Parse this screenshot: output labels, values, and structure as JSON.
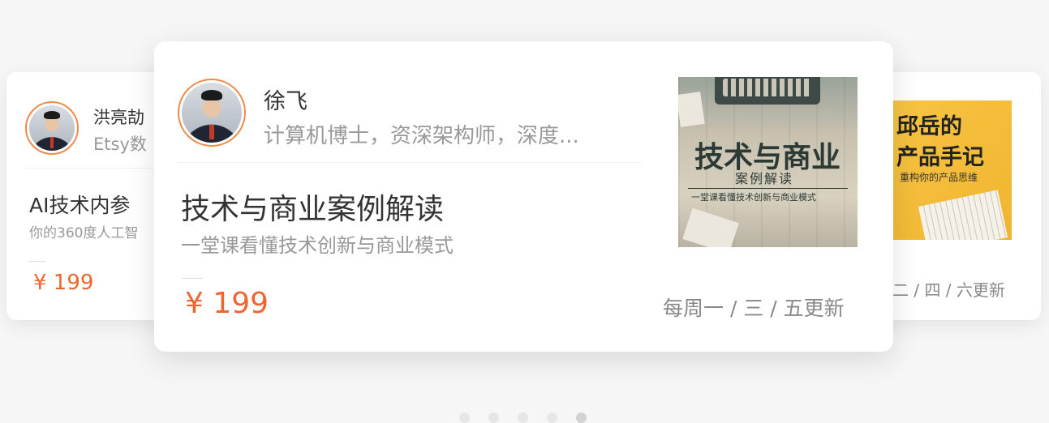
{
  "left_card": {
    "author_name": "洪亮劼",
    "author_desc": "Etsy数",
    "title": "AI技术内参",
    "subtitle": "你的360度人工智",
    "price": "¥ 199"
  },
  "main_card": {
    "author_name": "徐飞",
    "author_desc": "计算机博士，资深架构师，深度...",
    "title": "技术与商业案例解读",
    "subtitle": "一堂课看懂技术创新与商业模式",
    "price": "¥ 199",
    "update_schedule": "每周一 / 三 / 五更新",
    "cover": {
      "title": "技术与商业",
      "subtitle": "案例解读",
      "tagline": "一堂课看懂技术创新与商业模式"
    }
  },
  "right_card": {
    "cover": {
      "title_line1": "邱岳的",
      "title_line2": "产品手记",
      "tagline": "重构你的产品思维"
    },
    "update_schedule": "二 / 四 / 六更新"
  },
  "pagination": {
    "count": 5,
    "active_index": 4
  },
  "colors": {
    "price": "#f0652f",
    "avatar_ring": "#f08a4b"
  }
}
